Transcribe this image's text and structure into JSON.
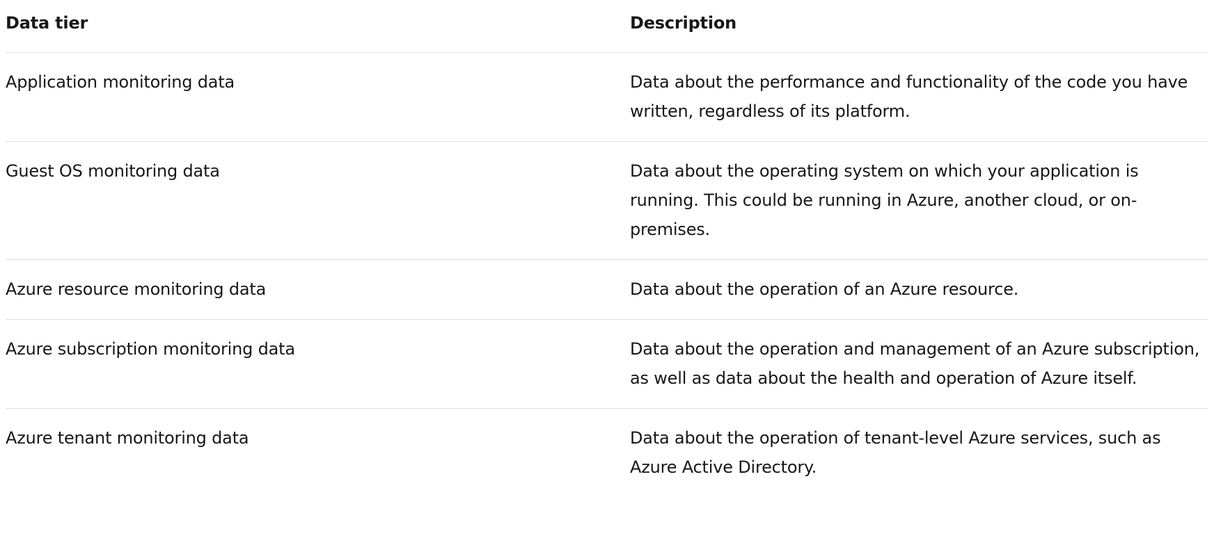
{
  "table": {
    "headers": {
      "tier": "Data tier",
      "description": "Description"
    },
    "rows": [
      {
        "tier": "Application monitoring data",
        "description": "Data about the performance and functionality of the code you have written, regardless of its platform."
      },
      {
        "tier": "Guest OS monitoring data",
        "description": "Data about the operating system on which your application is running. This could be running in Azure, another cloud, or on-premises."
      },
      {
        "tier": "Azure resource monitoring data",
        "description": "Data about the operation of an Azure resource."
      },
      {
        "tier": "Azure subscription monitoring data",
        "description": "Data about the operation and management of an Azure subscription, as well as data about the health and operation of Azure itself."
      },
      {
        "tier": "Azure tenant monitoring data",
        "description": "Data about the operation of tenant-level Azure services, such as Azure Active Directory."
      }
    ]
  }
}
